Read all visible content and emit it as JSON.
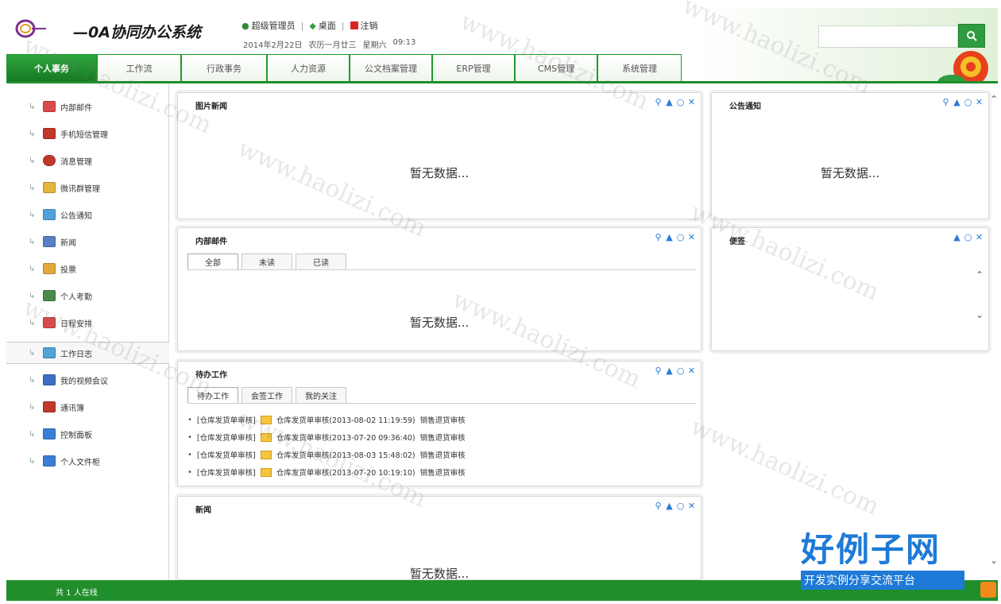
{
  "header": {
    "app_title": "—0A协同办公系统",
    "user_links": [
      {
        "label": "超级管理员",
        "icon": "user-icon"
      },
      {
        "label": "桌面",
        "icon": "desktop-icon"
      },
      {
        "label": "注销",
        "icon": "logout-icon"
      }
    ],
    "separator": "|",
    "date": "2014年2月22日",
    "lunar_date": "农历一月廿三",
    "weekday": "星期六",
    "time": "09:13",
    "search": {
      "placeholder": "",
      "value": ""
    }
  },
  "nav": {
    "tabs": [
      {
        "label": "个人事务",
        "active": true
      },
      {
        "label": "工作流",
        "active": false
      },
      {
        "label": "行政事务",
        "active": false
      },
      {
        "label": "人力资源",
        "active": false
      },
      {
        "label": "公文档案管理",
        "active": false
      },
      {
        "label": "ERP管理",
        "active": false
      },
      {
        "label": "CMS管理",
        "active": false
      },
      {
        "label": "系统管理",
        "active": false
      }
    ]
  },
  "sidebar": {
    "items": [
      {
        "label": "内部邮件",
        "icon": "mail-icon",
        "color": "#d94a4a"
      },
      {
        "label": "手机短信管理",
        "icon": "phone-icon",
        "color": "#c0392b"
      },
      {
        "label": "消息管理",
        "icon": "message-icon",
        "color": "#c0392b"
      },
      {
        "label": "微讯群管理",
        "icon": "group-icon",
        "color": "#e3b53a"
      },
      {
        "label": "公告通知",
        "icon": "notice-icon",
        "color": "#4fa3d9"
      },
      {
        "label": "新闻",
        "icon": "news-icon",
        "color": "#5a7fc2"
      },
      {
        "label": "投票",
        "icon": "vote-icon",
        "color": "#e3a93a"
      },
      {
        "label": "个人考勤",
        "icon": "attendance-icon",
        "color": "#4a8a4a"
      },
      {
        "label": "日程安排",
        "icon": "calendar-icon",
        "color": "#d94a4a"
      },
      {
        "label": "工作日志",
        "icon": "worklog-icon",
        "color": "#4fa3d9",
        "selected": true
      },
      {
        "label": "我的视频会议",
        "icon": "video-meeting-icon",
        "color": "#3a6fc2"
      },
      {
        "label": "通讯簿",
        "icon": "addressbook-icon",
        "color": "#c0392b"
      },
      {
        "label": "控制面板",
        "icon": "control-panel-icon",
        "color": "#3a7fd6"
      },
      {
        "label": "个人文件柜",
        "icon": "file-cabinet-icon",
        "color": "#3a7fd6"
      }
    ]
  },
  "panels": {
    "picture_news": {
      "title": "图片新闻",
      "empty": "暂无数据..."
    },
    "announcement": {
      "title": "公告通知",
      "empty": "暂无数据..."
    },
    "internal_mail": {
      "title": "内部邮件",
      "tabs": [
        "全部",
        "未读",
        "已读"
      ],
      "empty": "暂无数据..."
    },
    "memo": {
      "title": "便签"
    },
    "todo": {
      "title": "待办工作",
      "tabs": [
        "待办工作",
        "会签工作",
        "我的关注"
      ],
      "rows": [
        {
          "tag": "[仓库发货单审核]",
          "text": "仓库发货单审核(2013-08-02 11:19:59)",
          "step": "销售退货审核"
        },
        {
          "tag": "[仓库发货单审核]",
          "text": "仓库发货单审核(2013-07-20 09:36:40)",
          "step": "销售退货审核"
        },
        {
          "tag": "[仓库发货单审核]",
          "text": "仓库发货单审核(2013-08-03 15:48:02)",
          "step": "销售退货审核"
        },
        {
          "tag": "[仓库发货单审核]",
          "text": "仓库发货单审核(2013-07-20 10:19:10)",
          "step": "销售退货审核"
        }
      ]
    },
    "news": {
      "title": "新闻",
      "empty": "暂无数据..."
    }
  },
  "footer": {
    "online": "共 1 人在线"
  },
  "watermark": "www.haolizi.com",
  "brand": {
    "title": "好例子网",
    "subtitle": "开发实例分享交流平台"
  },
  "colors": {
    "primary_green": "#1f8e2b",
    "tool_blue": "#2a7bd6",
    "brand_blue": "#1e7ad6"
  }
}
